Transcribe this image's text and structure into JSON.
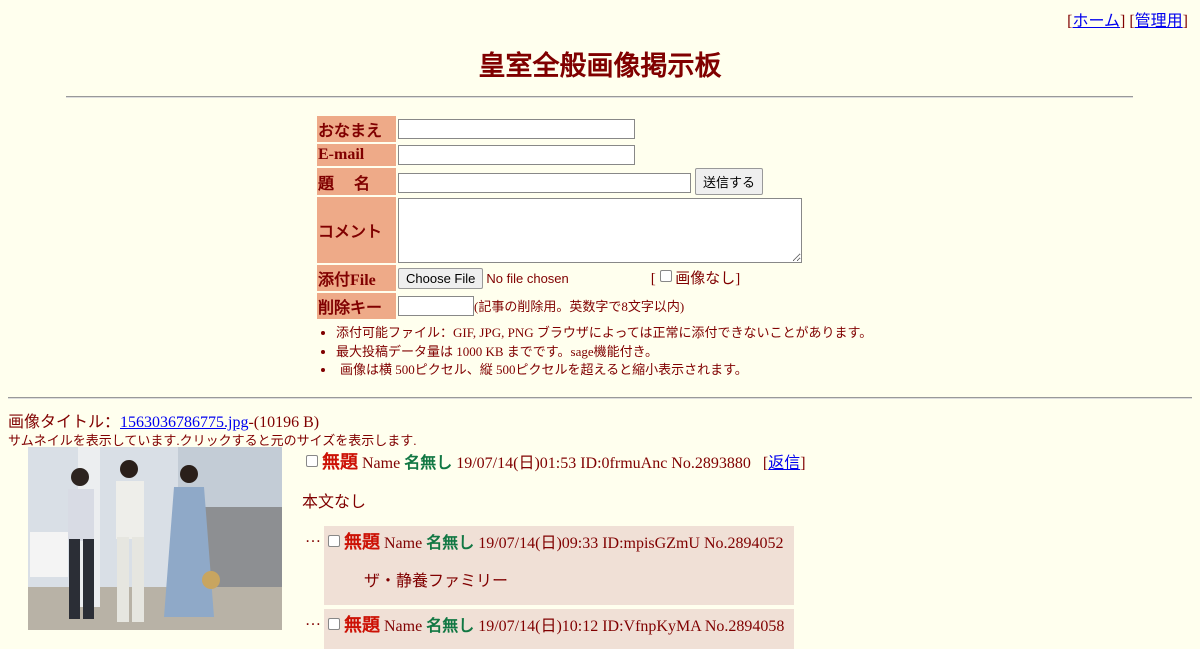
{
  "nav": {
    "home": "ホーム",
    "admin": "管理用"
  },
  "board_title": "皇室全般画像掲示板",
  "form": {
    "name_label": "おなまえ",
    "email_label": "E-mail",
    "subject_label": "題　 名",
    "submit_label": "送信する",
    "comment_label": "コメント",
    "file_label": "添付File",
    "file_button": "Choose File",
    "file_status": "No file chosen",
    "noimage_label": "画像なし",
    "delkey_label": "削除キー",
    "delkey_hint": "(記事の削除用。英数字で8文字以内)",
    "rules": [
      "添付可能ファイル：GIF, JPG, PNG ブラウザによっては正常に添付できないことがあります。",
      "最大投稿データ量は 1000 KB までです。sage機能付き。",
      "画像は横 500ピクセル、縦 500ピクセルを超えると縮小表示されます。"
    ]
  },
  "thread": {
    "image_title_label": "画像タイトル：",
    "image_file": "1563036786775.jpg",
    "image_size": "-(10196 B)",
    "thumb_note": "サムネイルを表示しています.クリックすると元のサイズを表示します.",
    "op": {
      "subject": "無題",
      "name_label": "Name",
      "name": "名無し",
      "meta": "19/07/14(日)01:53 ID:0frmuAnc No.2893880",
      "reply_link": "返信",
      "body": "本文なし"
    },
    "replies": [
      {
        "subject": "無題",
        "name_label": "Name",
        "name": "名無し",
        "meta": "19/07/14(日)09:33 ID:mpisGZmU No.2894052",
        "body": "ザ・静養ファミリー"
      },
      {
        "subject": "無題",
        "name_label": "Name",
        "name": "名無し",
        "meta": "19/07/14(日)10:12 ID:VfnpKyMA No.2894058",
        "body": ""
      }
    ]
  },
  "colors": {
    "background": "#ffffee",
    "text": "#800000",
    "label_bg": "#eeaa88",
    "subject": "#cc1105",
    "name": "#117743",
    "reply_bg": "#f0e0d6"
  }
}
